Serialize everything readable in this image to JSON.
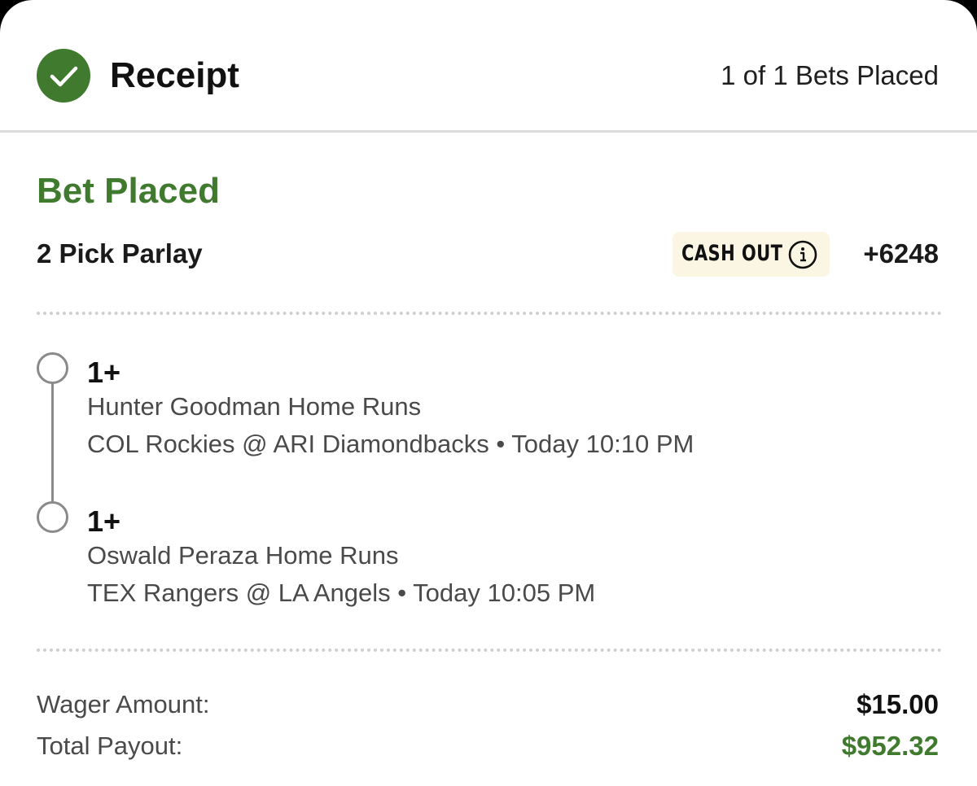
{
  "header": {
    "title": "Receipt",
    "bets_placed": "1 of 1 Bets Placed"
  },
  "bet": {
    "status": "Bet Placed",
    "type": "2 Pick Parlay",
    "cash_out_label": "CASH OUT",
    "odds": "+6248"
  },
  "legs": [
    {
      "value": "1+",
      "market": "Hunter Goodman Home Runs",
      "event": "COL Rockies @ ARI Diamondbacks • Today 10:10 PM"
    },
    {
      "value": "1+",
      "market": "Oswald Peraza Home Runs",
      "event": "TEX Rangers @ LA Angels • Today 10:05 PM"
    }
  ],
  "summary": {
    "wager_label": "Wager Amount:",
    "wager_value": "$15.00",
    "payout_label": "Total Payout:",
    "payout_value": "$952.32"
  },
  "icons": {
    "status": "check-circle-icon",
    "cash_out_info": "info-icon",
    "leg_marker": "open-circle-icon"
  },
  "colors": {
    "accent_green": "#3f7a2e",
    "cash_out_bg": "#fbf5e4",
    "text_primary": "#1a1a1a",
    "text_secondary": "#4a4a4a",
    "divider": "#cfcfcf"
  }
}
